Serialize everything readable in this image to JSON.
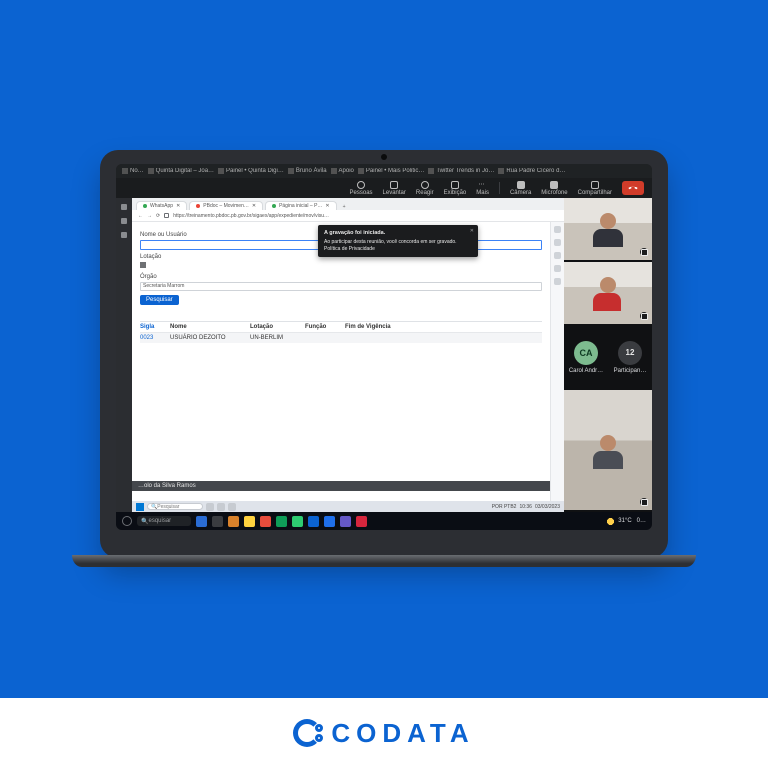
{
  "brand": "CODATA",
  "teams_tabs": [
    "No…",
    "Quinta Digital – Joã…",
    "Painel • Quinta Digi…",
    "Bruno Ávila",
    "Apoio",
    "Painel • Mais Politic…",
    "Twitter Trends in Jo…",
    "Rua Padre Cícero d…"
  ],
  "toolbar": {
    "pessoas": "Pessoas",
    "levantar": "Levantar",
    "reagir": "Reagir",
    "exibicao": "Exibição",
    "mais": "Mais",
    "camera": "Câmera",
    "microfone": "Microfone",
    "compartilhar": "Compartilhar"
  },
  "browser_tabs": [
    {
      "icon": "g",
      "label": "WhatsApp"
    },
    {
      "icon": "r",
      "label": "PBdoc – Movimen…"
    },
    {
      "icon": "g",
      "label": "Página inicial – P…"
    }
  ],
  "url": "https://treinamento.pbdoc.pb.gov.br/sigaex/app/expediente/mov/visu…",
  "form": {
    "lbl_user": "Nome ou Usuário",
    "lbl_lot": "Lotação",
    "lbl_org": "Órgão",
    "org_value": "Secretaria Marrom",
    "btn": "Pesquisar"
  },
  "table": {
    "h": [
      "Sigla",
      "Nome",
      "Lotação",
      "Função",
      "Fim de Vigência"
    ],
    "r": [
      "0023",
      "USUÁRIO DEZOITO",
      "UN-BERLIM",
      "",
      ""
    ]
  },
  "footer_name": "…olo da Silva Ramos",
  "toast": {
    "title": "A gravação foi iniciada.",
    "body": "Ao participar desta reunião, você concorda em ser gravado. Política de Privacidade"
  },
  "participants": {
    "avatar_initials": "CA",
    "avatar_label": "Carol Andr…",
    "count": "12",
    "count_label": "Participan…"
  },
  "inner_taskbar": {
    "search": "Pesquisar",
    "lang": "POR PTB2",
    "date": "03/03/2023",
    "time": "10:36"
  },
  "outer_taskbar": {
    "search": "esquisar",
    "temp": "31°C",
    "time": "0…"
  }
}
